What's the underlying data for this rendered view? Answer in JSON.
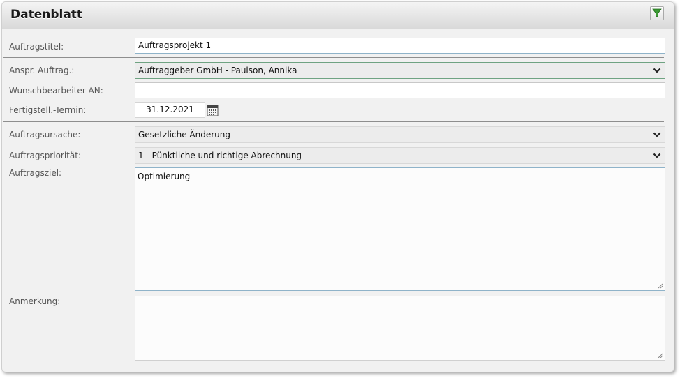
{
  "panel": {
    "title": "Datenblatt",
    "filter_icon": "filter-icon"
  },
  "form": {
    "auftragstitel": {
      "label": "Auftragstitel:",
      "value": "Auftragsprojekt 1"
    },
    "anspr_auftrag": {
      "label": "Anspr. Auftrag.:",
      "value": "Auftraggeber GmbH - Paulson, Annika"
    },
    "wunschbearbeiter": {
      "label": "Wunschbearbeiter AN:",
      "value": ""
    },
    "fertigstell_termin": {
      "label": "Fertigstell.-Termin:",
      "value": "31.12.2021",
      "icon": "calendar-icon"
    },
    "auftragsursache": {
      "label": "Auftragsursache:",
      "value": "Gesetzliche Änderung"
    },
    "auftragsprioritaet": {
      "label": "Auftragspriorität:",
      "value": "1 - Pünktliche und richtige Abrechnung"
    },
    "auftragsziel": {
      "label": "Auftragsziel:",
      "value": "Optimierung"
    },
    "anmerkung": {
      "label": "Anmerkung:",
      "value": ""
    }
  },
  "colors": {
    "panel_bg": "#f1f1f1",
    "focus_border": "#8fb3c9",
    "filter_green": "#3c9a34",
    "select_bg": "#ececec"
  }
}
